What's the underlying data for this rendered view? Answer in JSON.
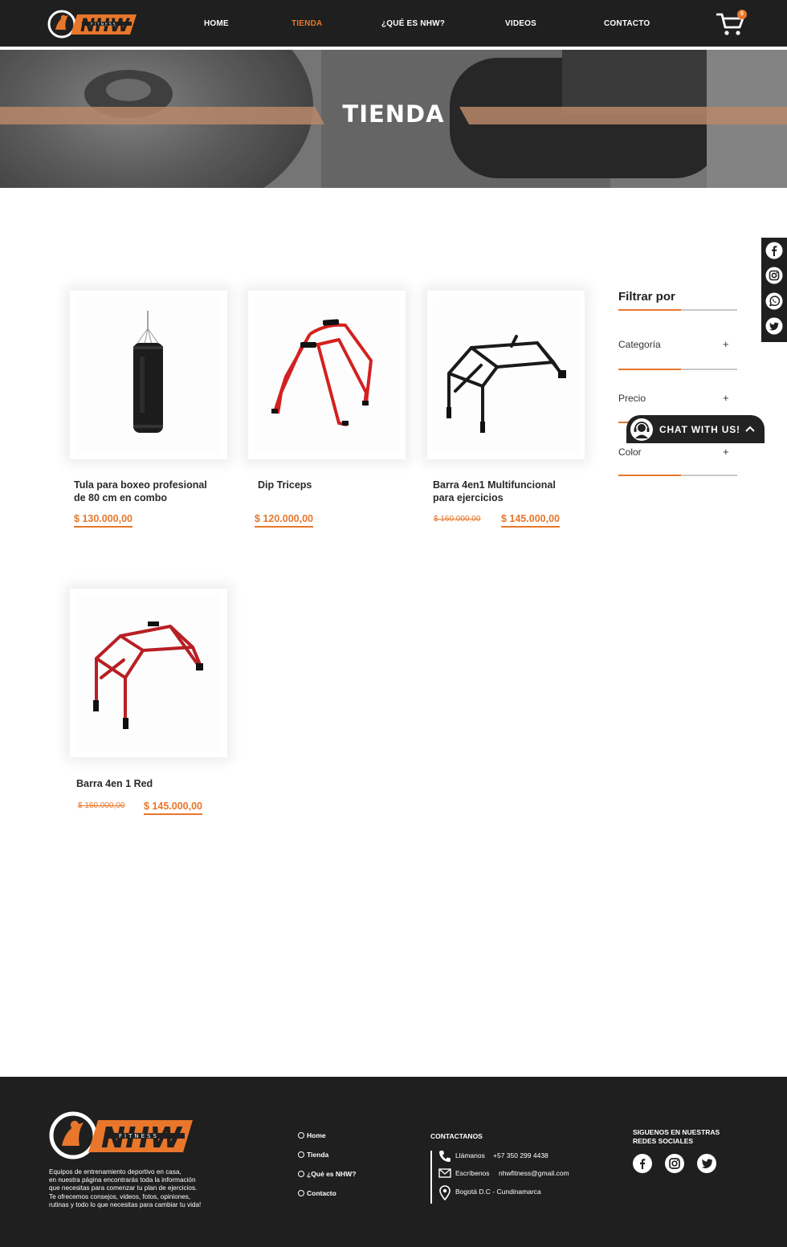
{
  "header": {
    "logo_alt": "NHW Fitness",
    "nav": [
      {
        "label": "HOME"
      },
      {
        "label": "TIENDA"
      },
      {
        "label": "¿QUÉ ES NHW?"
      },
      {
        "label": "VIDEOS"
      },
      {
        "label": "CONTACTO"
      }
    ],
    "active_nav": "TIENDA",
    "cart_count": "0"
  },
  "hero": {
    "title": "TIENDA"
  },
  "products": [
    {
      "name": "Tula para boxeo profesional de 80 cm en combo",
      "price": "$ 130.000,00",
      "old_price": "",
      "image": "punching-bag"
    },
    {
      "name": "Dip Triceps",
      "price": "$ 120.000,00",
      "old_price": "",
      "image": "dip-station-red"
    },
    {
      "name": "Barra 4en1 Multifuncional para ejercicios",
      "price": "$ 145.000,00",
      "old_price": "$ 160.000,00",
      "image": "pullup-bar-black"
    },
    {
      "name": "Barra 4en 1 Red",
      "price": "$ 145.000,00",
      "old_price": "$ 160.000,00",
      "image": "pullup-bar-red"
    }
  ],
  "filters": {
    "title": "Filtrar por",
    "items": [
      {
        "label": "Categoría",
        "toggle": "+"
      },
      {
        "label": "Precio",
        "toggle": "+"
      },
      {
        "label": "Color",
        "toggle": "+"
      }
    ]
  },
  "social_sidebar": [
    "facebook-icon",
    "instagram-icon",
    "whatsapp-icon",
    "twitter-icon"
  ],
  "chat": {
    "label": "CHAT WITH US!"
  },
  "footer": {
    "description": "Equipos de entrenamiento deportivo en casa, en nuestra página encontrarás toda la información que necesitas para comenzar tu plan de ejercicios. Te ofrecemos consejos, videos, fotos, opiniones, rutinas y todo lo que necesitas para cambiar tu vida!",
    "description_lines": [
      "Equipos de entrenamiento deportivo en casa,",
      "en nuestra página encontrarás toda la información",
      "que necesitas para comenzar tu plan de ejercicios.",
      "Te ofrecemos consejos, videos, fotos, opiniones,",
      "rutinas y todo lo que necesitas para cambiar tu vida!"
    ],
    "links": [
      "Home",
      "Tienda",
      "¿Qué es NHW?",
      "Contacto"
    ],
    "contact_heading": "CONTACTANOS",
    "contact": {
      "call_label": "Llámanos",
      "phone": "+57 350 299 4438",
      "write_label": "Escríbenos",
      "email": "nhwfitness@gmail.com",
      "address": "Bogotá D.C - Cundinamarca"
    },
    "social_heading": "SIGUENOS EN NUESTRAS REDES SOCIALES",
    "social_heading_lines": [
      "SIGUENOS EN NUESTRAS",
      "REDES SOCIALES"
    ],
    "social": [
      "facebook-icon",
      "instagram-icon",
      "twitter-icon"
    ]
  },
  "colors": {
    "accent": "#e8772b",
    "dark": "#1f1f1f",
    "text": "#222222"
  }
}
